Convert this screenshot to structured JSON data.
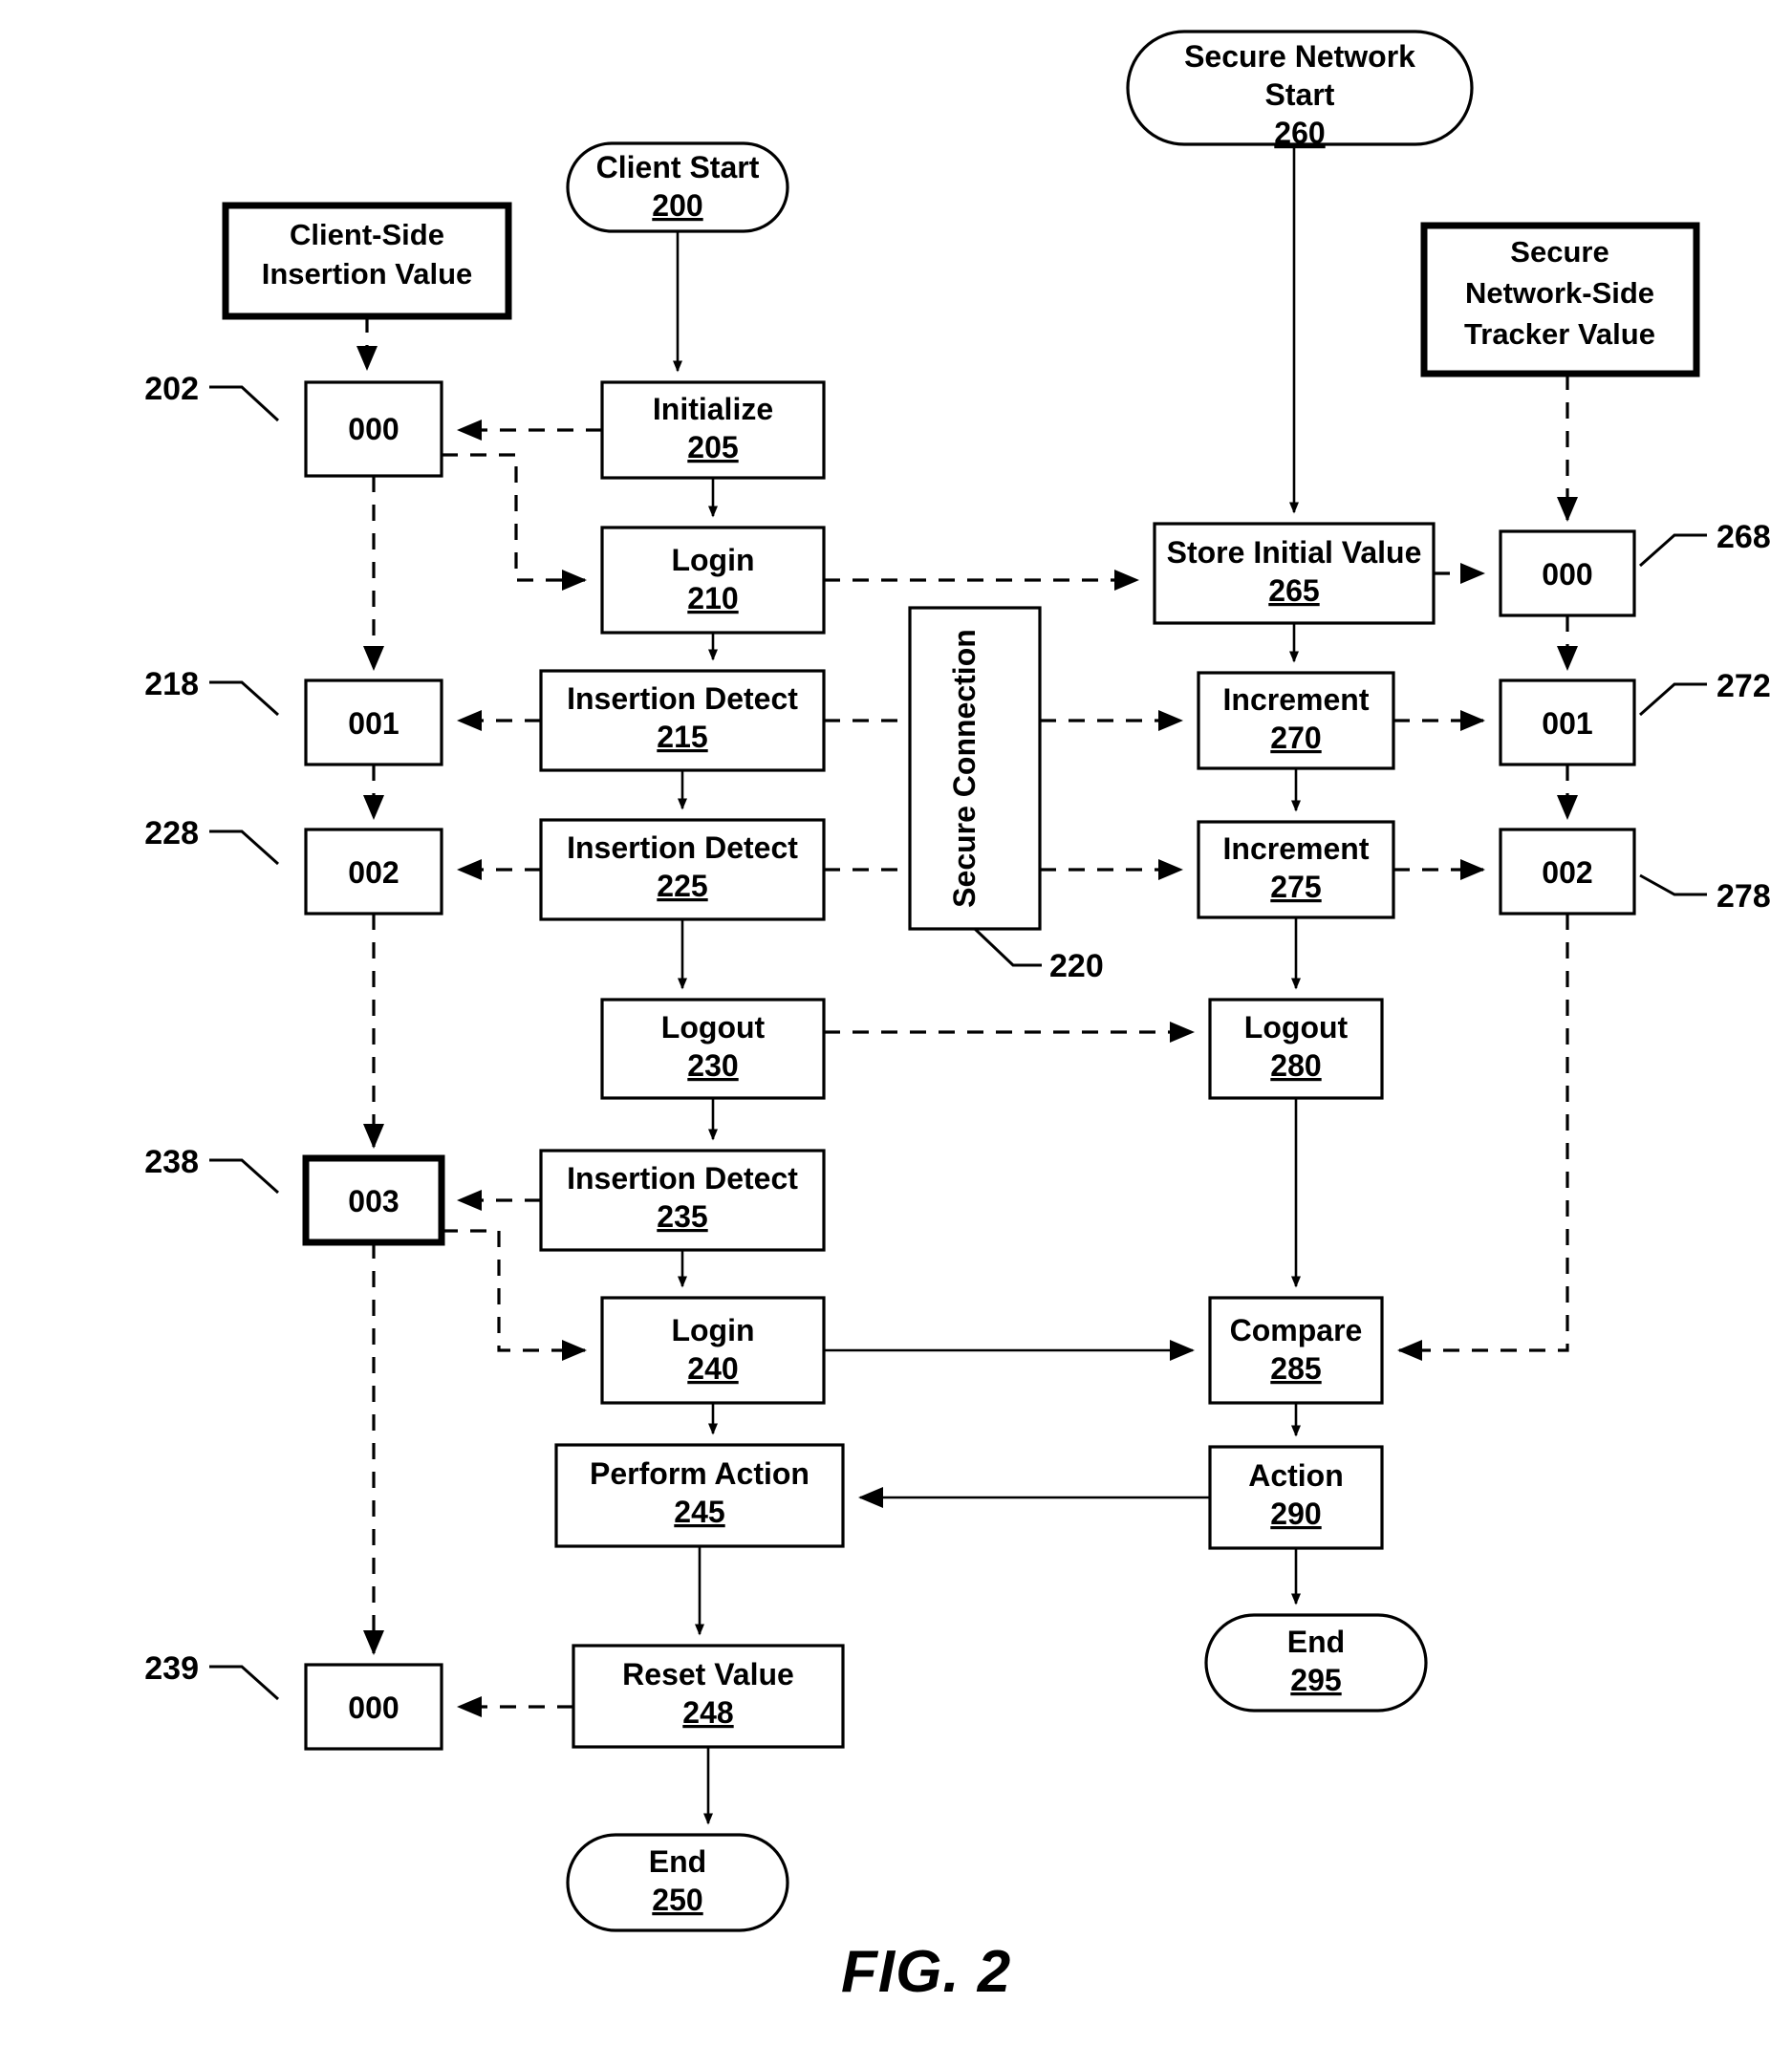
{
  "figure": {
    "caption": "FIG. 2"
  },
  "headers": {
    "client_side": {
      "line1": "Client-Side",
      "line2": "Insertion Value"
    },
    "network_side": {
      "line1": "Secure",
      "line2": "Network-Side",
      "line3": "Tracker Value"
    }
  },
  "terminators": {
    "client_start": {
      "label": "Client Start",
      "ref": "200"
    },
    "client_end": {
      "label": "End",
      "ref": "250"
    },
    "network_start_line1": "Secure Network",
    "network_start_line2": "Start",
    "network_start_ref": "260",
    "network_end": {
      "label": "End",
      "ref": "295"
    }
  },
  "client_steps": [
    {
      "label": "Initialize",
      "ref": "205"
    },
    {
      "label": "Login",
      "ref": "210"
    },
    {
      "label": "Insertion Detect",
      "ref": "215"
    },
    {
      "label": "Insertion Detect",
      "ref": "225"
    },
    {
      "label": "Logout",
      "ref": "230"
    },
    {
      "label": "Insertion Detect",
      "ref": "235"
    },
    {
      "label": "Login",
      "ref": "240"
    },
    {
      "label": "Perform Action",
      "ref": "245"
    },
    {
      "label": "Reset Value",
      "ref": "248"
    }
  ],
  "network_steps": [
    {
      "label": "Store Initial Value",
      "ref": "265"
    },
    {
      "label": "Increment",
      "ref": "270"
    },
    {
      "label": "Increment",
      "ref": "275"
    },
    {
      "label": "Logout",
      "ref": "280"
    },
    {
      "label": "Compare",
      "ref": "285"
    },
    {
      "label": "Action",
      "ref": "290"
    }
  ],
  "client_values": [
    {
      "value": "000",
      "ref": "202"
    },
    {
      "value": "001",
      "ref": "218"
    },
    {
      "value": "002",
      "ref": "228"
    },
    {
      "value": "003",
      "ref": "238"
    },
    {
      "value": "000",
      "ref": "239"
    }
  ],
  "network_values": [
    {
      "value": "000",
      "ref": "268"
    },
    {
      "value": "001",
      "ref": "272"
    },
    {
      "value": "002",
      "ref": "278"
    }
  ],
  "secure_connection": {
    "label": "Secure Connection",
    "ref": "220"
  },
  "colors": {
    "ink": "#000000",
    "paper": "#ffffff"
  }
}
